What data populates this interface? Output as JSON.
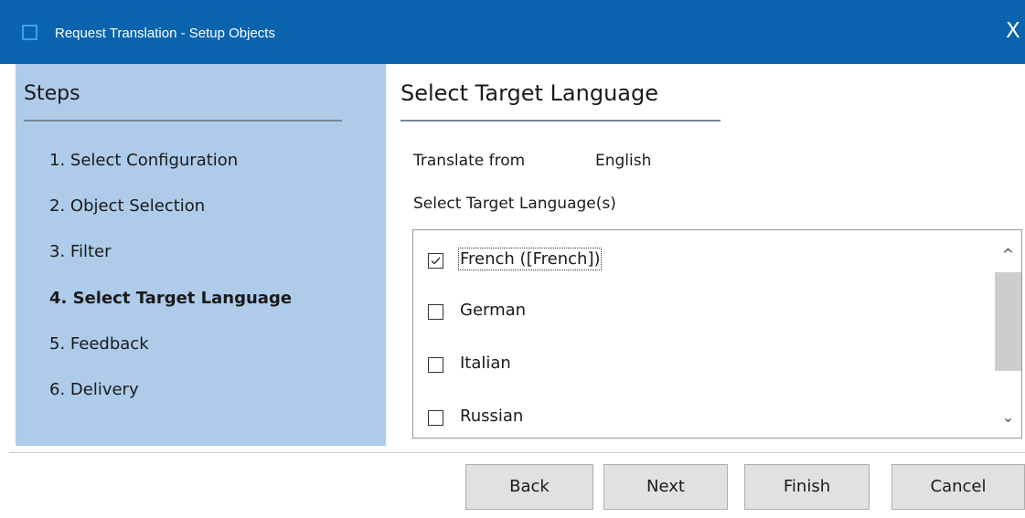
{
  "window": {
    "title": "Request Translation - Setup Objects",
    "close_symbol": "X",
    "icons": [
      "app-icon",
      "close-icon"
    ]
  },
  "steps": {
    "heading": "Steps",
    "items": [
      {
        "label": "1. Select Configuration",
        "active": false
      },
      {
        "label": "2. Object Selection",
        "active": false
      },
      {
        "label": "3. Filter",
        "active": false
      },
      {
        "label": "4. Select Target Language",
        "active": true
      },
      {
        "label": "5. Feedback",
        "active": false
      },
      {
        "label": "6. Delivery",
        "active": false
      }
    ]
  },
  "main": {
    "heading": "Select Target Language",
    "translate_from_label": "Translate from",
    "translate_from_value": "English",
    "target_label": "Select Target Language(s)",
    "languages": [
      {
        "label": "French ([French])",
        "checked": true
      },
      {
        "label": "German",
        "checked": false
      },
      {
        "label": "Italian",
        "checked": false
      },
      {
        "label": "Russian",
        "checked": false
      }
    ],
    "scroll_up_symbol": "^",
    "scroll_down_symbol": "⌄"
  },
  "buttons": {
    "back": "Back",
    "next": "Next",
    "finish": "Finish",
    "cancel": "Cancel"
  },
  "colors": {
    "titlebar": "#0a64ad",
    "steps_pane": "#aecbe9",
    "button_face": "#e1e1e1"
  }
}
